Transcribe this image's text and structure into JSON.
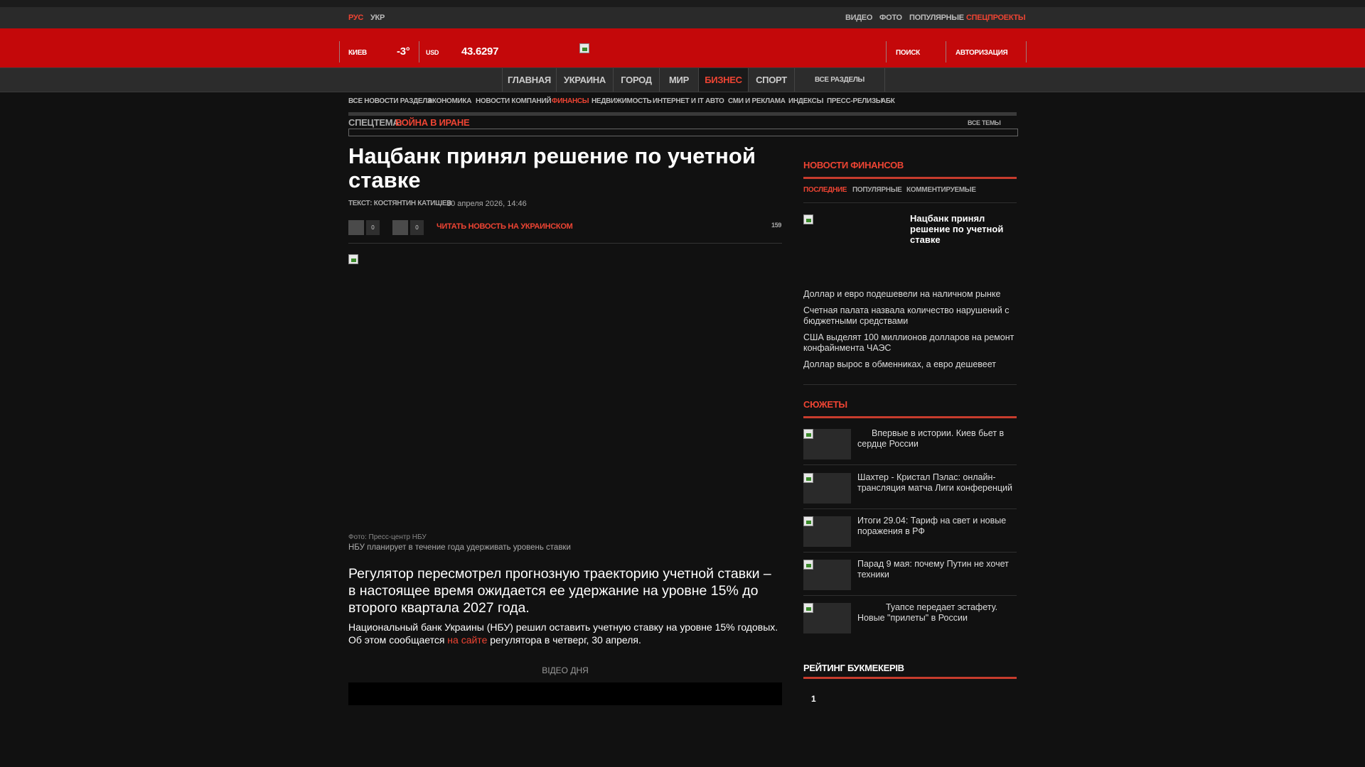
{
  "lang": {
    "rus": "РУС",
    "ukr": "УКР"
  },
  "top_nav": [
    "ВИДЕО",
    "ФОТО",
    "ПОПУЛЯРНЫЕ",
    "СПЕЦПРОЕКТЫ"
  ],
  "header": {
    "city": "КИЕВ",
    "temperature": "-3°",
    "currency": "USD",
    "rate": "43.6297",
    "search": "ПОИСК",
    "auth": "АВТОРИЗАЦИЯ"
  },
  "main_nav": [
    "ГЛАВНАЯ",
    "УКРАИНА",
    "ГОРОД",
    "МИР",
    "БИЗНЕС",
    "СПОРТ",
    "ВСЕ РАЗДЕЛЫ"
  ],
  "sub_nav": [
    "ВСЕ НОВОСТИ РАЗДЕЛА",
    "ЭКОНОМИКА",
    "НОВОСТИ КОМПАНИЙ",
    "ФИНАНСЫ",
    "НЕДВИЖИМОСТЬ",
    "ИНТЕРНЕТ И IT",
    "АВТО",
    "СМИ И РЕКЛАМА",
    "ИНДЕКСЫ",
    "ПРЕСС-РЕЛИЗЫ",
    "АБК"
  ],
  "spec": {
    "label": "СПЕЦТЕМА:",
    "topic": "ВОЙНА В ИРАНЕ",
    "all": "ВСЕ ТЕМЫ"
  },
  "article": {
    "title": "Нацбанк принял решение по учетной ставке",
    "author": "ТЕКСТ: КОСТЯНТИН КАТИШЕВ",
    "date": "30 апреля 2026, 14:46",
    "likes": "0",
    "dislikes": "0",
    "read_ukr": "ЧИТАТЬ НОВОСТЬ НА УКРАИНСКОМ",
    "views": "159",
    "photo_credit": "Фото: Пресс-центр НБУ",
    "caption": "НБУ планирует в течение года удерживать уровень ставки",
    "lead": "Регулятор пересмотрел прогнозную траекторию учетной ставки – в настоящее время ожидается ее удержание на уровне 15% до второго квартала 2027 года.",
    "body_before": "Национальный банк Украины (НБУ) решил оставить учетную ставку на уровне 15% годовых. Об этом сообщается ",
    "body_link": "на сайте",
    "body_after": " регулятора в четверг, 30 апреля.",
    "video_label": "ВІДЕО ДНЯ"
  },
  "finance_news": {
    "title": "НОВОСТИ ФИНАНСОВ",
    "tabs": [
      "ПОСЛЕДНИЕ",
      "ПОПУЛЯРНЫЕ",
      "КОММЕНТИРУЕМЫЕ"
    ],
    "featured": "Нацбанк принял решение по учетной ставке",
    "items": [
      "Доллар и евро подешевели на наличном рынке",
      "Счетная палата назвала количество нарушений с бюджетными средствами",
      "США выделят 100 миллионов долларов на ремонт конфайнмента ЧАЭС",
      "Доллар вырос в обменниках, а евро дешевеет"
    ]
  },
  "stories": {
    "title": "СЮЖЕТЫ",
    "items": [
      "Впервые в истории. Киев бьет в сердце России",
      "Шахтер - Кристал Пэлас: онлайн-трансляция матча Лиги конференций",
      "Итоги 29.04: Тариф на свет и новые поражения в РФ",
      "Парад 9 мая: почему Путин не хочет техники",
      "Туапсе передает эстафету. Новые \"прилеты\" в России"
    ]
  },
  "bookmakers": {
    "title": "РЕЙТИНГ БУКМЕКЕРІВ",
    "first": "1"
  },
  "colors": {
    "accent": "#ee4433",
    "header_red": "#c4080a",
    "background": "#111111"
  }
}
